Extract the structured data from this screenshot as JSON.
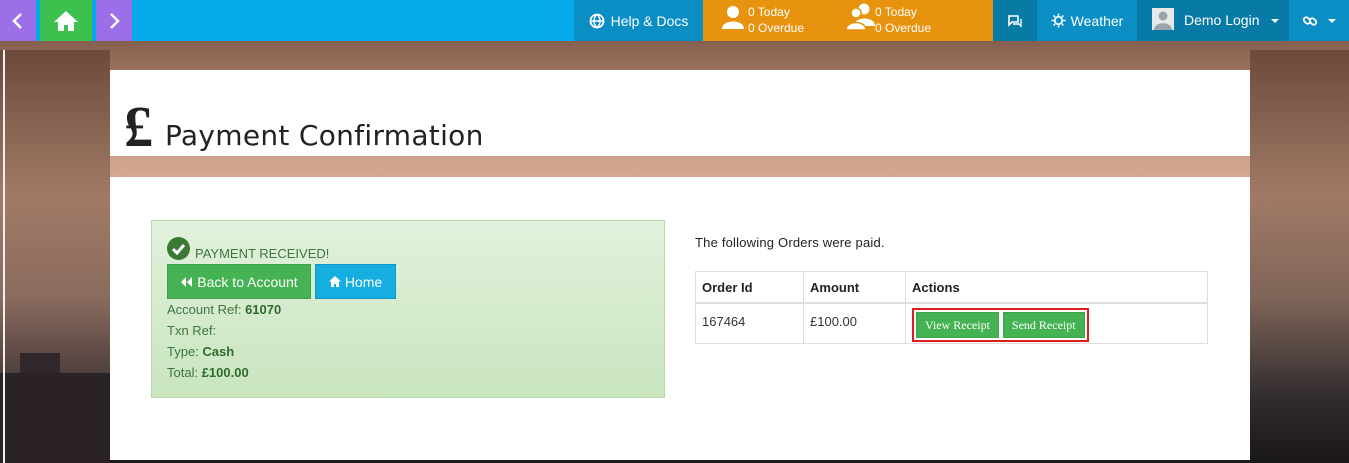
{
  "topbar": {
    "help_label": "Help & Docs",
    "tasks": [
      {
        "today": "0 Today",
        "overdue": "0 Overdue"
      },
      {
        "today": "0 Today",
        "overdue": "0 Overdue"
      }
    ],
    "weather_label": "Weather",
    "user_label": "Demo Login"
  },
  "page": {
    "currency_symbol": "£",
    "title": "Payment Confirmation"
  },
  "payment": {
    "status": "PAYMENT RECEIVED!",
    "back_button": "Back to Account",
    "home_button": "Home",
    "account_ref_label": "Account Ref:",
    "account_ref": "61070",
    "txn_ref_label": "Txn Ref:",
    "txn_ref": "",
    "type_label": "Type:",
    "type": "Cash",
    "total_label": "Total:",
    "total": "£100.00"
  },
  "orders": {
    "intro": "The following Orders were paid.",
    "columns": [
      "Order Id",
      "Amount",
      "Actions"
    ],
    "rows": [
      {
        "order_id": "167464",
        "amount": "£100.00",
        "view_label": "View Receipt",
        "send_label": "Send Receipt"
      }
    ]
  },
  "colors": {
    "topbar": "#03a9e8",
    "nav_purple": "#9c6ee8",
    "nav_green": "#3cc04e",
    "tasks_orange": "#e8930f",
    "success_green": "#45b353",
    "highlight_red": "#d9201f"
  },
  "icons": [
    "chevron-left-icon",
    "home-icon",
    "chevron-right-icon",
    "globe-icon",
    "user-icon",
    "users-icon",
    "chat-icon",
    "sun-icon",
    "avatar",
    "link-icon",
    "check-circle-icon",
    "double-chevron-left-icon"
  ]
}
